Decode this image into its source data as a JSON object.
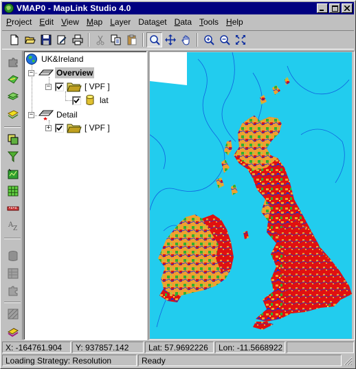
{
  "window": {
    "title": "VMAP0 - MapLink Studio 4.0"
  },
  "menu": [
    {
      "pre": "",
      "u": "P",
      "post": "roject"
    },
    {
      "pre": "",
      "u": "E",
      "post": "dit"
    },
    {
      "pre": "",
      "u": "V",
      "post": "iew"
    },
    {
      "pre": "",
      "u": "M",
      "post": "ap"
    },
    {
      "pre": "",
      "u": "L",
      "post": "ayer"
    },
    {
      "pre": "Data",
      "u": "s",
      "post": "et"
    },
    {
      "pre": "",
      "u": "D",
      "post": "ata"
    },
    {
      "pre": "",
      "u": "T",
      "post": "ools"
    },
    {
      "pre": "",
      "u": "H",
      "post": "elp"
    }
  ],
  "tree": {
    "root": "UK&Ireland",
    "overview": "Overview",
    "overview_vpf": "[ VPF ]",
    "lat": "lat",
    "detail": "Detail",
    "detail_vpf": "[ VPF ]",
    "expand_minus": "−",
    "expand_plus": "+"
  },
  "status": {
    "x": "X: -164761.904",
    "y": "Y: 937857.142",
    "lat": "Lat: 57.9692226",
    "lon": "Lon: -11.5668922",
    "strategy": "Loading Strategy: Resolution",
    "state": "Ready"
  },
  "colors": {
    "titlebar": "#000080",
    "sea": "#22ccee",
    "land_red": "#e01010",
    "land_orange": "#f0a030",
    "land_green": "#30b030",
    "land_blue": "#1030e0"
  }
}
